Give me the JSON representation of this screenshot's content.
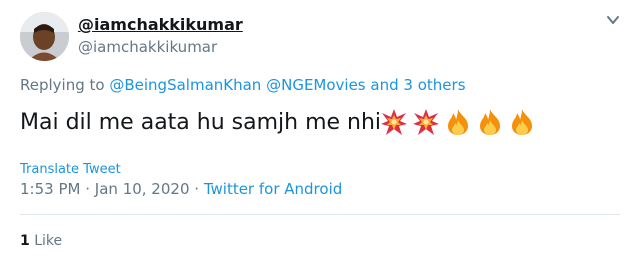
{
  "tweet": {
    "display_name": "@iamchakkikumar",
    "handle": "@iamchakkikumar",
    "replying": {
      "prefix": "Replying to",
      "mention1": "@BeingSalmanKhan",
      "mention2": "@NGEMovies",
      "others_join": "and",
      "others": "3 others"
    },
    "text": "Mai dil me aata hu samjh me nhi",
    "emojis": [
      "collision",
      "collision",
      "fire",
      "fire",
      "fire"
    ],
    "translate_label": "Translate Tweet",
    "time": "1:53 PM",
    "date": "Jan 10, 2020",
    "separator": "·",
    "source": "Twitter for Android",
    "likes_count": "1",
    "likes_label": "Like"
  },
  "colors": {
    "link": "#1b95e0",
    "muted": "#657786",
    "text": "#14171a",
    "divider": "#e1e8ed"
  }
}
